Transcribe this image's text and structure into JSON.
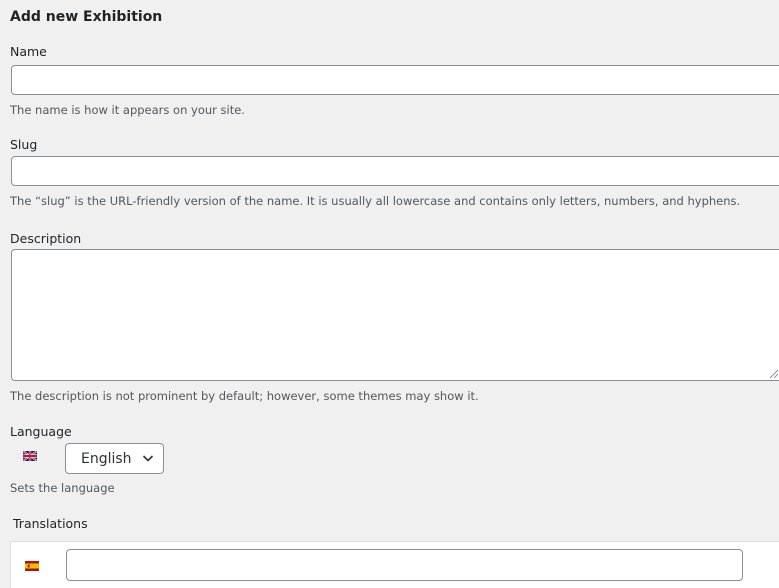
{
  "form": {
    "title": "Add new Exhibition",
    "name": {
      "label": "Name",
      "value": "",
      "help": "The name is how it appears on your site."
    },
    "slug": {
      "label": "Slug",
      "value": "",
      "help": "The “slug” is the URL-friendly version of the name. It is usually all lowercase and contains only letters, numbers, and hyphens."
    },
    "description": {
      "label": "Description",
      "value": "",
      "help": "The description is not prominent by default; however, some themes may show it."
    },
    "language": {
      "label": "Language",
      "flag_icon": "uk-flag-icon",
      "selected": "English",
      "options": [
        "English"
      ],
      "help": "Sets the language"
    },
    "translations": {
      "label": "Translations",
      "items": [
        {
          "flag_icon": "spain-flag-icon",
          "value": ""
        }
      ]
    }
  },
  "colors": {
    "background": "#f0f0f1",
    "input_border": "#8c8f94",
    "help_text": "#50575e"
  }
}
